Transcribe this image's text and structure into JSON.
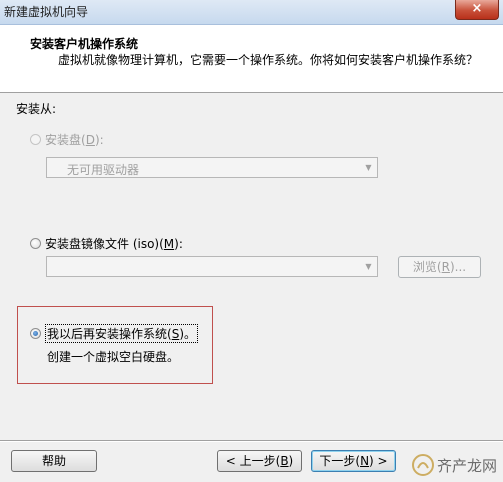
{
  "window": {
    "title": "新建虚拟机向导",
    "close_symbol": "×"
  },
  "header": {
    "title": "安装客户机操作系统",
    "description": "虚拟机就像物理计算机，它需要一个操作系统。你将如何安装客户机操作系统？"
  },
  "install_from": {
    "label": "安装从:",
    "options": [
      {
        "label_prefix": "安装盘(",
        "hotkey": "D",
        "label_suffix": "):",
        "selected": false,
        "enabled": false
      },
      {
        "label_prefix": "安装盘镜像文件 (iso)(",
        "hotkey": "M",
        "label_suffix": "):",
        "selected": false,
        "enabled": true
      },
      {
        "label_prefix": "我以后再安装操作系统(",
        "hotkey": "S",
        "label_suffix": ")。",
        "selected": true,
        "enabled": true
      }
    ],
    "drive_combo_value": "无可用驱动器",
    "iso_combo_value": "",
    "browse_button": {
      "label_prefix": "浏览(",
      "hotkey": "R",
      "label_suffix": ")..."
    },
    "later_description": "创建一个虚拟空白硬盘。"
  },
  "footer": {
    "help_label": "帮助",
    "back_button": {
      "label_prefix": "< 上一步(",
      "hotkey": "B",
      "label_suffix": ")"
    },
    "next_button": {
      "label_prefix": "下一步(",
      "hotkey": "N",
      "label_suffix": ") >"
    }
  },
  "watermark": {
    "text": "齐产龙网"
  },
  "colors": {
    "highlight_box": "#c0504d",
    "radio_selected": "#1f5fa8"
  }
}
